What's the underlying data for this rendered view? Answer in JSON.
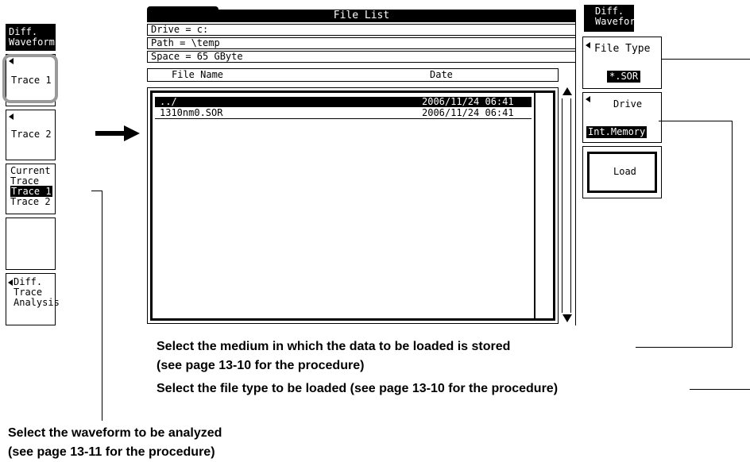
{
  "left_menu": {
    "title_line1": "Diff.",
    "title_line2": "Waveform",
    "trace1_label": "Trace 1",
    "trace2_label": "Trace 2",
    "current_line1": "Current",
    "current_line2": "Trace",
    "current_option1": "Trace 1",
    "current_option2": "Trace 2",
    "analysis_line1": "Diff.",
    "analysis_line2": "Trace",
    "analysis_line3": "Analysis"
  },
  "file_list": {
    "title": "File List",
    "drive": "Drive = c:",
    "path": "Path = \\temp",
    "space": "Space = 65 GByte",
    "col_name": "File Name",
    "col_date": "Date",
    "rows": [
      {
        "name": "../",
        "date": "2006/11/24 06:41"
      },
      {
        "name": "1310nm0.SOR",
        "date": "2006/11/24 06:41"
      }
    ]
  },
  "right_menu": {
    "title_line1": "Diff.",
    "title_line2": "Waveform",
    "file_type_label": "File Type",
    "file_type_value": "*.SOR",
    "drive_label": "Drive",
    "drive_value": "Int.Memory",
    "load_label": "Load"
  },
  "annotations": {
    "medium_line1": "Select the medium in which the data to be loaded is stored",
    "medium_line2": "(see page 13-10 for the procedure)",
    "filetype": "Select the file type to be loaded (see page 13-10 for the procedure)",
    "waveform_line1": "Select the waveform to be analyzed",
    "waveform_line2": "(see page 13-11 for the procedure)"
  },
  "colors": {
    "screen_bg": "#ffffff",
    "highlight": "#000000",
    "callout_frame": "#9a9a9a"
  }
}
